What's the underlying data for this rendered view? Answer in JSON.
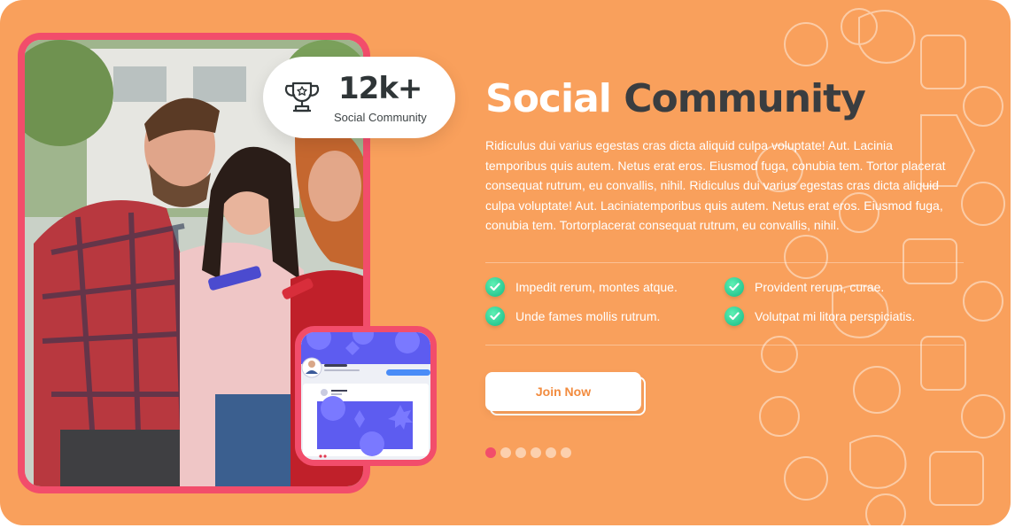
{
  "badge": {
    "value": "12k+",
    "label": "Social Community",
    "icon": "trophy-icon"
  },
  "hero": {
    "title_part1": "Social",
    "title_part2": "Community",
    "description": "Ridiculus dui varius egestas cras dicta aliquid culpa voluptate! Aut. Lacinia temporibus quis autem. Netus erat eros. Eiusmod fuga, conubia tem. Tortor placerat consequat rutrum, eu convallis, nihil. Ridiculus dui varius egestas cras dicta aliquid culpa voluptate! Aut. Laciniatemporibus quis autem. Netus erat eros. Eiusmod fuga, conubia tem. Tortorplacerat consequat rutrum, eu convallis, nihil."
  },
  "features": [
    {
      "label": "Impedit rerum, montes atque.",
      "icon": "check-icon"
    },
    {
      "label": "Provident rerum, curae.",
      "icon": "check-icon"
    },
    {
      "label": "Unde fames mollis rutrum.",
      "icon": "check-icon"
    },
    {
      "label": "Volutpat mi litora perspiciatis.",
      "icon": "check-icon"
    }
  ],
  "cta": {
    "label": "Join Now"
  },
  "pager": {
    "count": 6,
    "active_index": 0
  },
  "colors": {
    "background": "#f9a05c",
    "accent": "#f24d6b",
    "title_dark": "#3a3d40",
    "check_green": "#14b983",
    "mock_purple": "#5d5cf0"
  }
}
